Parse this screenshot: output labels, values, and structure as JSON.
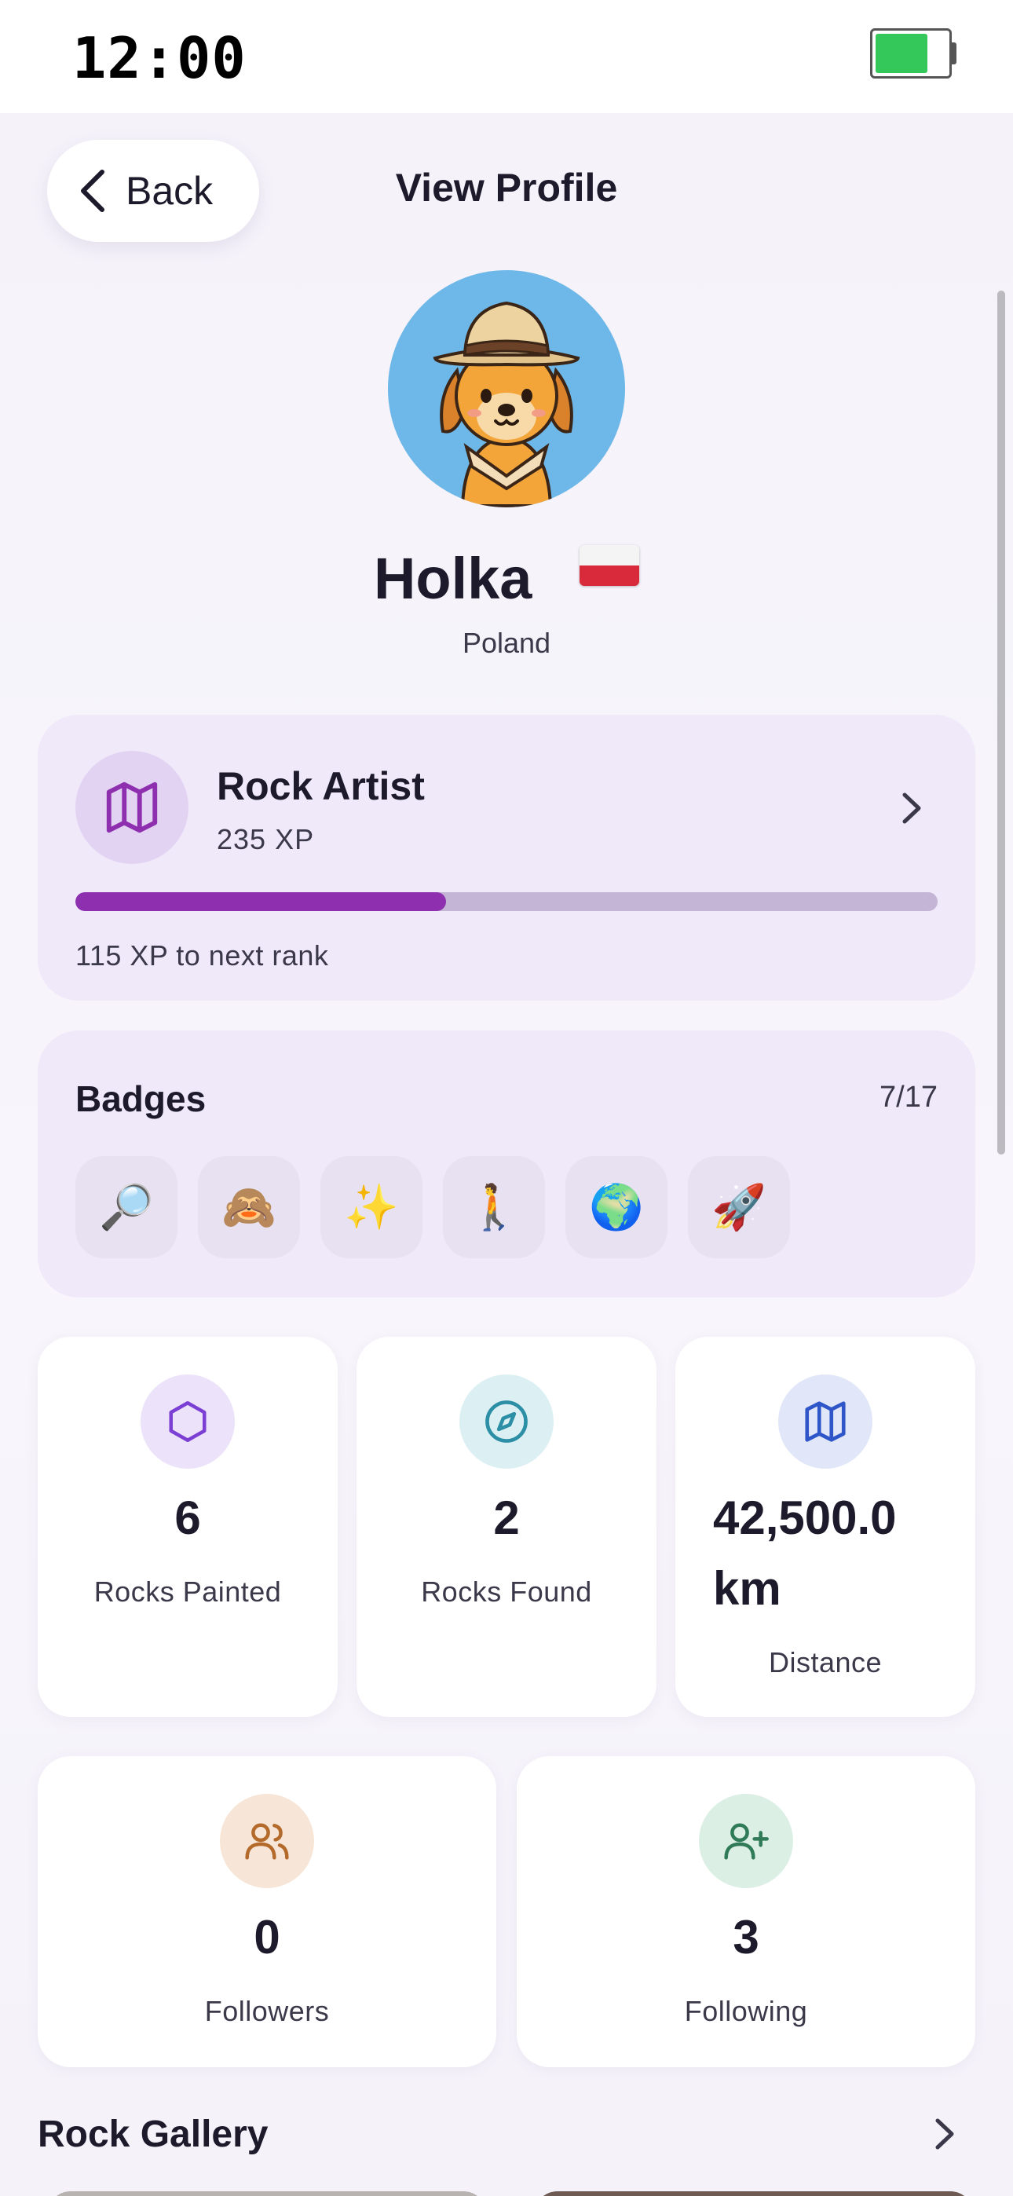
{
  "status_bar": {
    "time": "12:00",
    "battery_level": 0.75,
    "battery_color": "#34c759"
  },
  "nav": {
    "back_label": "Back",
    "title": "View Profile"
  },
  "profile": {
    "name": "Holka",
    "country": "Poland",
    "flag": "poland-flag",
    "avatar": "explorer-dog-avatar",
    "avatar_bg_color": "#6db8e8"
  },
  "rank": {
    "title": "Rock Artist",
    "xp": "235 XP",
    "progress": 0.43,
    "next_rank_text": "115 XP to next rank",
    "icon": "map-icon",
    "accent_color": "#8e2fb0"
  },
  "badges": {
    "title": "Badges",
    "count": "7/17",
    "items": [
      "🔎",
      "🙈",
      "✨",
      "🚶",
      "🌍",
      "🚀"
    ]
  },
  "stats": {
    "rocks_painted": {
      "value": "6",
      "label": "Rocks Painted",
      "icon": "hexagon-icon",
      "color": "#7b3fd4"
    },
    "rocks_found": {
      "value": "2",
      "label": "Rocks Found",
      "icon": "compass-icon",
      "color": "#2c8fa6"
    },
    "distance": {
      "value": "42,500.0 km",
      "value_line1": "42,500.0",
      "value_line2": "km",
      "label": "Distance",
      "icon": "map-icon",
      "color": "#2f56c8"
    },
    "followers": {
      "value": "0",
      "label": "Followers",
      "icon": "users-icon",
      "color": "#b36a2a"
    },
    "following": {
      "value": "3",
      "label": "Following",
      "icon": "user-plus-icon",
      "color": "#2f7a57"
    }
  },
  "gallery": {
    "title": "Rock Gallery"
  }
}
